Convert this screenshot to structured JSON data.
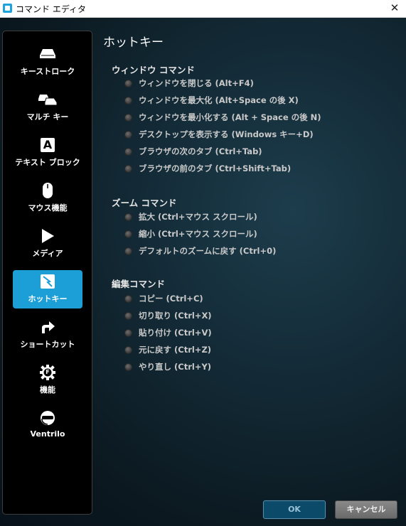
{
  "window": {
    "title": "コマンド エディタ",
    "close_glyph": "✕"
  },
  "sidebar": {
    "items": [
      {
        "label": "キーストローク",
        "icon": "keystroke-icon",
        "active": false
      },
      {
        "label": "マルチ キー",
        "icon": "multikey-icon",
        "active": false
      },
      {
        "label": "テキスト ブロック",
        "icon": "text-block-icon",
        "icon_glyph": "A",
        "active": false
      },
      {
        "label": "マウス機能",
        "icon": "mouse-icon",
        "active": false
      },
      {
        "label": "メディア",
        "icon": "play-icon",
        "active": false
      },
      {
        "label": "ホットキー",
        "icon": "hotkey-icon",
        "active": true
      },
      {
        "label": "ショートカット",
        "icon": "shortcut-arrow-icon",
        "active": false
      },
      {
        "label": "機能",
        "icon": "function-gear-icon",
        "icon_glyph": "F",
        "active": false
      },
      {
        "label": "Ventrilo",
        "icon": "headset-icon",
        "active": false
      }
    ]
  },
  "content": {
    "title": "ホットキー",
    "sections": [
      {
        "title": "ウィンドウ コマンド",
        "options": [
          "ウィンドウを閉じる (Alt+F4)",
          "ウィンドウを最大化 (Alt+Space の後 X)",
          "ウィンドウを最小化する (Alt + Space の後 N)",
          "デスクトップを表示する (Windows キー+D)",
          "ブラウザの次のタブ (Ctrl+Tab)",
          "ブラウザの前のタブ (Ctrl+Shift+Tab)"
        ]
      },
      {
        "title": "ズーム コマンド",
        "options": [
          "拡大 (Ctrl+マウス スクロール)",
          "縮小 (Ctrl+マウス スクロール)",
          "デフォルトのズームに戻す (Ctrl+0)"
        ]
      },
      {
        "title": "編集コマンド",
        "options": [
          "コピー (Ctrl+C)",
          "切り取り (Ctrl+X)",
          "貼り付け (Ctrl+V)",
          "元に戻す (Ctrl+Z)",
          "やり直し (Ctrl+Y)"
        ]
      }
    ]
  },
  "buttons": {
    "ok": "OK",
    "cancel": "キャンセル"
  },
  "colors": {
    "accent": "#1b9fd6",
    "ok_bg": "#0b4a69",
    "cancel_bg": "#7a7a7a"
  }
}
